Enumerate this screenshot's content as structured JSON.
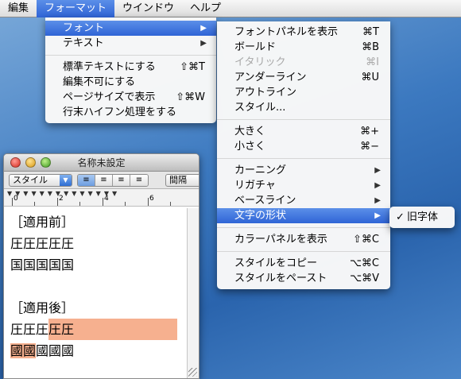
{
  "menubar": {
    "items": [
      {
        "label": "編集",
        "active": false
      },
      {
        "label": "フォーマット",
        "active": true
      },
      {
        "label": "ウインドウ",
        "active": false
      },
      {
        "label": "ヘルプ",
        "active": false
      }
    ]
  },
  "format_menu": {
    "font": "フォント",
    "text": "テキスト",
    "make_plain": "標準テキストにする",
    "make_plain_sc": "⇧⌘T",
    "prevent_editing": "編集不可にする",
    "wrap_to_page": "ページサイズで表示",
    "wrap_to_page_sc": "⇧⌘W",
    "hyphenation": "行末ハイフン処理をする"
  },
  "font_menu": {
    "show_fonts": "フォントパネルを表示",
    "show_fonts_sc": "⌘T",
    "bold": "ボールド",
    "bold_sc": "⌘B",
    "italic": "イタリック",
    "italic_sc": "⌘I",
    "underline": "アンダーライン",
    "underline_sc": "⌘U",
    "outline": "アウトライン",
    "styles": "スタイル...",
    "bigger": "大きく",
    "bigger_sc": "⌘+",
    "smaller": "小さく",
    "smaller_sc": "⌘−",
    "kern": "カーニング",
    "ligature": "リガチャ",
    "baseline": "ベースライン",
    "character_shape": "文字の形状",
    "show_colors": "カラーパネルを表示",
    "show_colors_sc": "⇧⌘C",
    "copy_style": "スタイルをコピー",
    "copy_style_sc": "⌥⌘C",
    "paste_style": "スタイルをペースト",
    "paste_style_sc": "⌥⌘V"
  },
  "shape_menu": {
    "check": "✓",
    "traditional": "旧字体"
  },
  "document": {
    "title": "名称未設定",
    "style_select": "スタイル",
    "spacing_select": "間隔",
    "ruler_numbers": [
      "0",
      "2",
      "4",
      "6"
    ],
    "lines": [
      {
        "text": "［適用前］"
      },
      {
        "text": "圧圧圧圧圧"
      },
      {
        "text": "国国国国国"
      },
      {
        "text": ""
      },
      {
        "text": "［適用後］"
      },
      {
        "plain": "圧圧圧",
        "highlighted": "圧圧"
      },
      {
        "highlighted": "國國",
        "plain": "國國國"
      }
    ]
  },
  "colors": {
    "menu_highlight": "#3a6fdc",
    "text_highlight": "#f6b08f"
  }
}
